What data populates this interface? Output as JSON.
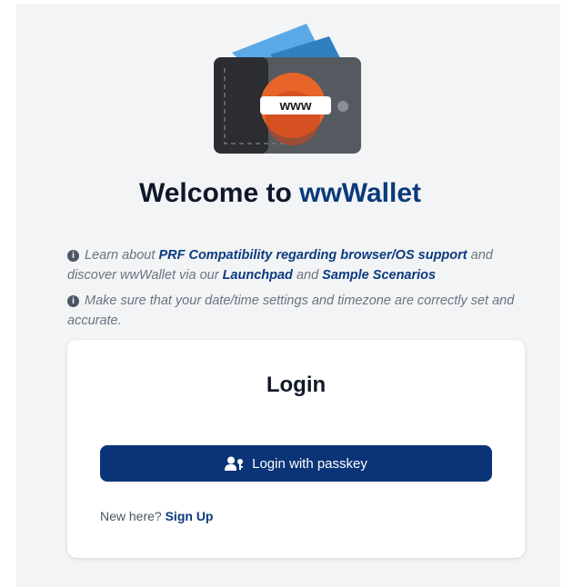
{
  "header": {
    "title_prefix": "Welcome to ",
    "title_brand": "wwWallet",
    "logo_text": "www",
    "logo_icon": "wallet-logo"
  },
  "info": {
    "line1": {
      "icon": "info-icon",
      "text1": "Learn about ",
      "link_prf": "PRF Compatibility regarding browser/OS support",
      "text2": " and discover wwWallet via our ",
      "link_launchpad": "Launchpad",
      "text3": " and ",
      "link_scenarios": "Sample Scenarios"
    },
    "line2": {
      "icon": "info-icon",
      "text": "Make sure that your date/time settings and timezone are correctly set and accurate."
    }
  },
  "login": {
    "title": "Login",
    "passkey_button": "Login with passkey",
    "passkey_icon": "user-key-icon",
    "signup_prompt": "New here? ",
    "signup_link": "Sign Up"
  },
  "colors": {
    "brand": "#0a3a7a",
    "button": "#0b3478",
    "panel_bg": "#f3f4f6"
  }
}
